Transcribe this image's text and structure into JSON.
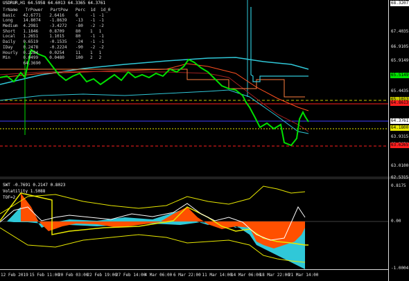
{
  "chart": {
    "title": "USDRUR,H1  64.5958 64.6013 64.3365 64.3761",
    "accent_colors": {
      "price": "#00e000",
      "red": "#ff2020",
      "cyan": "#30c8d8",
      "bull": "#ffffff"
    }
  },
  "table": {
    "headers": [
      "TrName",
      "TrPower",
      "PartPow",
      "Perc",
      "1d",
      "1d_0"
    ],
    "rows": [
      [
        "Basic",
        "42.6771",
        "2.6416",
        "6",
        "-1",
        "-1"
      ],
      [
        "Long",
        "14.8074",
        "-1.8639",
        "-13",
        "-1",
        "-1"
      ],
      [
        "Medium",
        "4.2981",
        "-3.4272",
        "-80",
        "-2",
        "-2"
      ],
      [
        "Short",
        "1.1846",
        "0.8709",
        "80",
        "1",
        "1"
      ],
      [
        "Local",
        "1.2651",
        "1.1015",
        "80",
        "-1",
        "-1"
      ],
      [
        "Daily",
        "0.6519",
        "-0.1535",
        "-24",
        "-1",
        "-1"
      ],
      [
        "IDay",
        "0.2478",
        "-0.2224",
        "-90",
        "-2",
        "-2"
      ],
      [
        "Hourly",
        "0.2284",
        "0.0254",
        "11",
        "1",
        "1"
      ],
      [
        "Min",
        "0.0499",
        "0.0480",
        "100",
        "2",
        "2"
      ],
      [
        "",
        "64.3690",
        "",
        "",
        "",
        ""
      ]
    ]
  },
  "price_axis": {
    "labels": [
      "68.3207",
      "67.4035",
      "66.9105",
      "65.9149",
      "65.4435",
      "64.3761",
      "64.1800",
      "63.9315",
      "63.5050",
      "63.0100",
      "62.5315",
      "0.8175",
      "0.00",
      "-1.0004"
    ],
    "tags": [
      {
        "text": "68.3207",
        "color": "#ffffff"
      },
      {
        "text": "65.5149",
        "color": "#00e000"
      },
      {
        "text": "65.1013",
        "color": "#c8c800"
      },
      {
        "text": "64.8613",
        "color": "#ff2020"
      },
      {
        "text": "64.3761",
        "color": "#ffffff"
      },
      {
        "text": "64.1800",
        "color": "#e8e800"
      },
      {
        "text": "63.6265",
        "color": "#ff2020"
      }
    ]
  },
  "time_axis": {
    "labels": [
      "12 Feb 2019",
      "15 Feb 11:00",
      "20 Feb 03:00",
      "22 Feb 19:00",
      "27 Feb 14:00",
      "4 Mar 06:00",
      "6 Mar 22:00",
      "11 Mar 14:00",
      "14 Mar 06:00",
      "18 Mar 22:00",
      "21 Mar 14:00"
    ]
  },
  "indicator": {
    "title": "SWT -0.7691 0.2147 0.8023",
    "sub1": "Volatility 1.5088",
    "sub2": "TOF=2"
  }
}
